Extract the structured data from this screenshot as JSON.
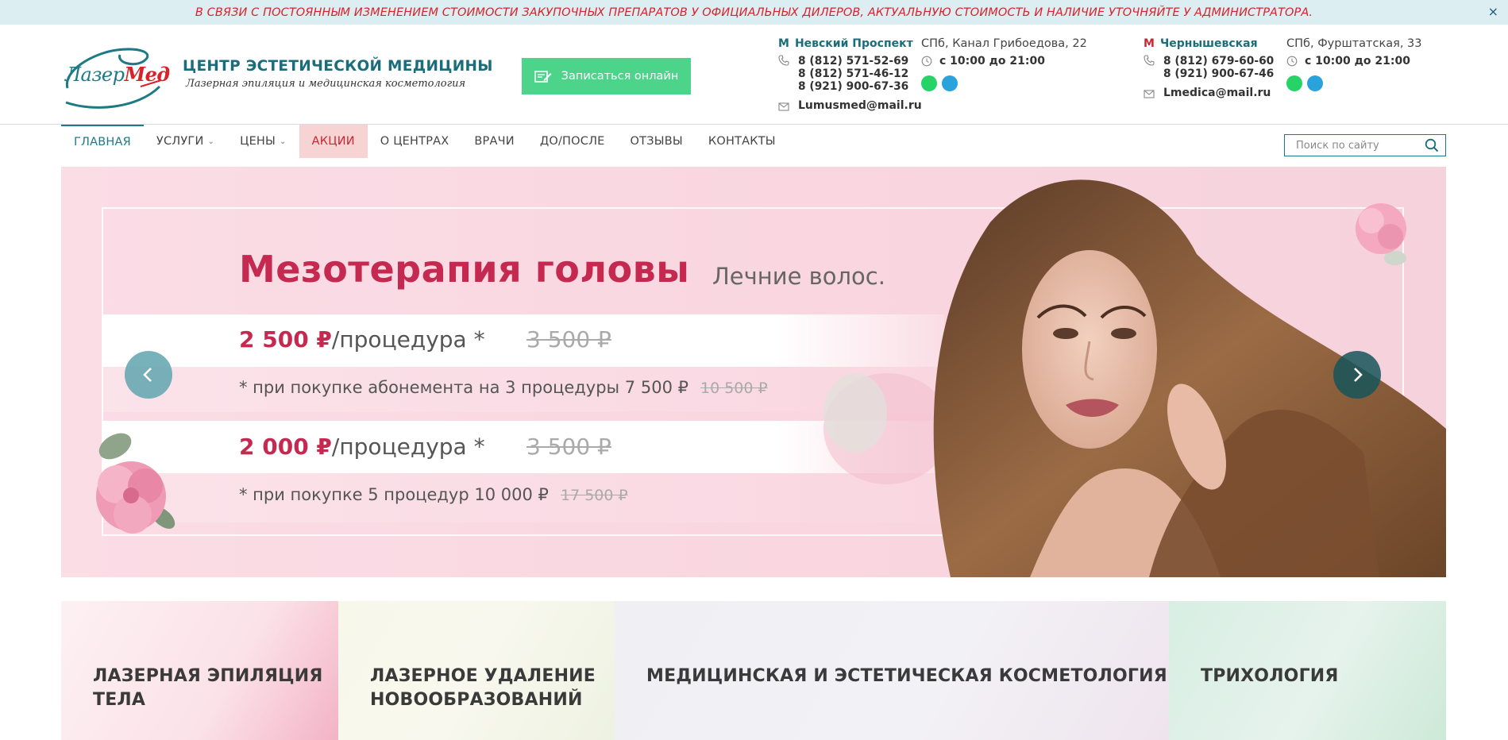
{
  "notice": {
    "text": "В СВЯЗИ С ПОСТОЯННЫМ ИЗМЕНЕНИЕМ СТОИМОСТИ ЗАКУПОЧНЫХ ПРЕПАРАТОВ У ОФИЦИАЛЬНЫХ ДИЛЕРОВ, АКТУАЛЬНУЮ СТОИМОСТЬ И НАЛИЧИЕ УТОЧНЯЙТЕ У АДМИНИСТРАТОРА.",
    "close": "×"
  },
  "logo": {
    "part1": "Лазер",
    "part2": "Мед"
  },
  "brand": {
    "title": "ЦЕНТР ЭСТЕТИЧЕСКОЙ МЕДИЦИНЫ",
    "subtitle": "Лазерная эпиляция и медицинская косметология"
  },
  "book_button": "Записаться онлайн",
  "contacts": [
    {
      "metro_icon": "М",
      "metro": "Невский Проспект",
      "metro_color": "#1b6d7c",
      "phones": [
        "8 (812) 571-52-69",
        "8 (812) 571-46-12",
        "8 (921) 900-67-36"
      ],
      "email": "Lumusmed@mail.ru",
      "address": "СПб, Канал Грибоедова, 22",
      "hours": "с 10:00 до 21:00"
    },
    {
      "metro_icon": "М",
      "metro": "Чернышевская",
      "metro_color": "#c62833",
      "phones": [
        "8 (812) 679-60-60",
        "8 (921) 900-67-46"
      ],
      "email": "Lmedica@mail.ru",
      "address": "СПб, Фурштатская, 33",
      "hours": "с 10:00 до 21:00"
    }
  ],
  "messengers": {
    "whatsapp_color": "#25d366",
    "telegram_color": "#2aa3dc",
    "icons": [
      "whatsapp-icon",
      "telegram-icon"
    ]
  },
  "nav": {
    "items": [
      {
        "label": "ГЛАВНАЯ",
        "dropdown": false
      },
      {
        "label": "УСЛУГИ",
        "dropdown": true
      },
      {
        "label": "ЦЕНЫ",
        "dropdown": true
      },
      {
        "label": "АКЦИИ",
        "dropdown": false
      },
      {
        "label": "О ЦЕНТРАХ",
        "dropdown": false
      },
      {
        "label": "ВРАЧИ",
        "dropdown": false
      },
      {
        "label": "ДО/ПОСЛЕ",
        "dropdown": false
      },
      {
        "label": "ОТЗЫВЫ",
        "dropdown": false
      },
      {
        "label": "КОНТАКТЫ",
        "dropdown": false
      }
    ],
    "active": "ГЛАВНАЯ",
    "highlight": "АКЦИИ"
  },
  "search": {
    "placeholder": "Поиск по сайту"
  },
  "slide": {
    "title": "Мезотерапия головы",
    "subtitle": "Лечние волос.",
    "offer1": {
      "price": "2 500 ₽",
      "unit": "/процедура *",
      "old_price": "3 500 ₽"
    },
    "note1": {
      "text": "* при покупке абонемента на 3 процедуры 7 500 ₽",
      "old": "10 500 ₽"
    },
    "offer2": {
      "price": "2 000 ₽",
      "unit": "/процедура *",
      "old_price": "3 500 ₽"
    },
    "note2": {
      "text": "* при покупке 5 процедур 10 000 ₽",
      "old": "17 500 ₽"
    }
  },
  "categories": [
    {
      "line1": "ЛАЗЕРНАЯ ЭПИЛЯЦИЯ",
      "line2": "ТЕЛА"
    },
    {
      "line1": "ЛАЗЕРНОЕ УДАЛЕНИЕ",
      "line2": "НОВООБРАЗОВАНИЙ"
    },
    {
      "line1": "МЕДИЦИНСКАЯ И ЭСТЕТИЧЕСКАЯ КОСМЕТОЛОГИЯ",
      "line2": ""
    },
    {
      "line1": "ТРИХОЛОГИЯ",
      "line2": ""
    }
  ],
  "colors": {
    "accent": "#1b7a86",
    "promo": "#c62833",
    "button": "#4dd48b",
    "slide_title": "#c5294f"
  }
}
